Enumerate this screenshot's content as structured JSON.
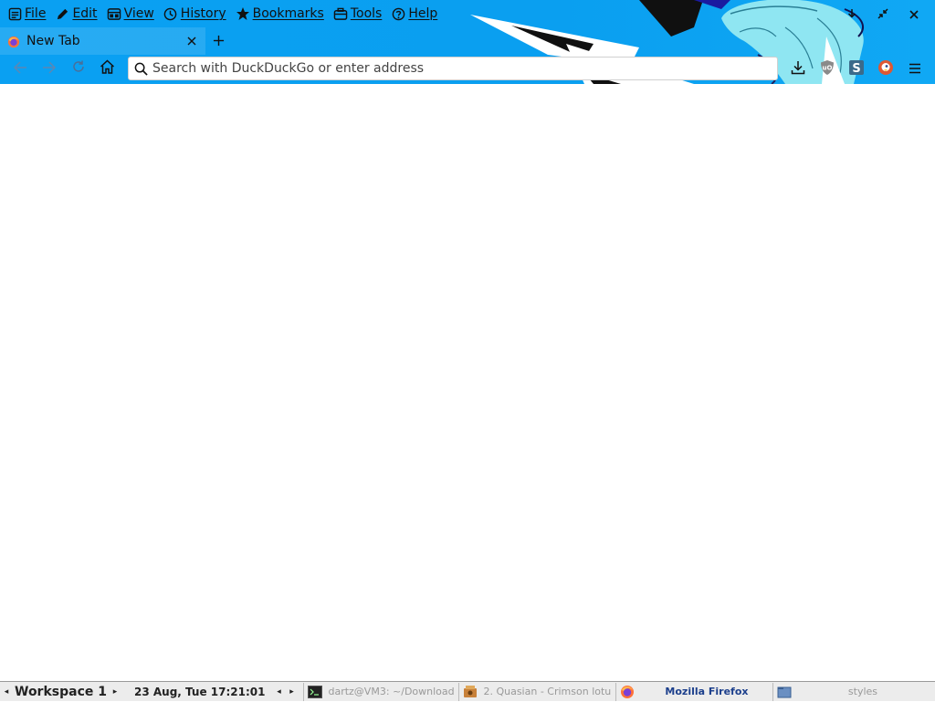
{
  "menubar": {
    "items": [
      {
        "label": "File",
        "icon": "file-icon"
      },
      {
        "label": "Edit",
        "icon": "pencil-icon"
      },
      {
        "label": "View",
        "icon": "view-icon"
      },
      {
        "label": "History",
        "icon": "clock-icon"
      },
      {
        "label": "Bookmarks",
        "icon": "star-icon"
      },
      {
        "label": "Tools",
        "icon": "toolbox-icon"
      },
      {
        "label": "Help",
        "icon": "help-icon"
      }
    ]
  },
  "tabs": [
    {
      "title": "New Tab",
      "active": true
    }
  ],
  "urlbar": {
    "placeholder": "Search with DuckDuckGo or enter address",
    "value": ""
  },
  "taskbar": {
    "workspace": "Workspace 1",
    "clock": "23 Aug, Tue 17:21:01",
    "tasks": [
      {
        "label": "dartz@VM3: ~/Download",
        "icon": "terminal-icon",
        "active": false
      },
      {
        "label": "2. Quasian - Crimson lotu",
        "icon": "media-player-icon",
        "active": false
      },
      {
        "label": "Mozilla Firefox",
        "icon": "firefox-icon",
        "active": true
      },
      {
        "label": "styles",
        "icon": "folder-icon",
        "active": false
      }
    ]
  },
  "colors": {
    "theme_blue": "#0aa0f2",
    "active_task_text": "#1c3f8c"
  }
}
